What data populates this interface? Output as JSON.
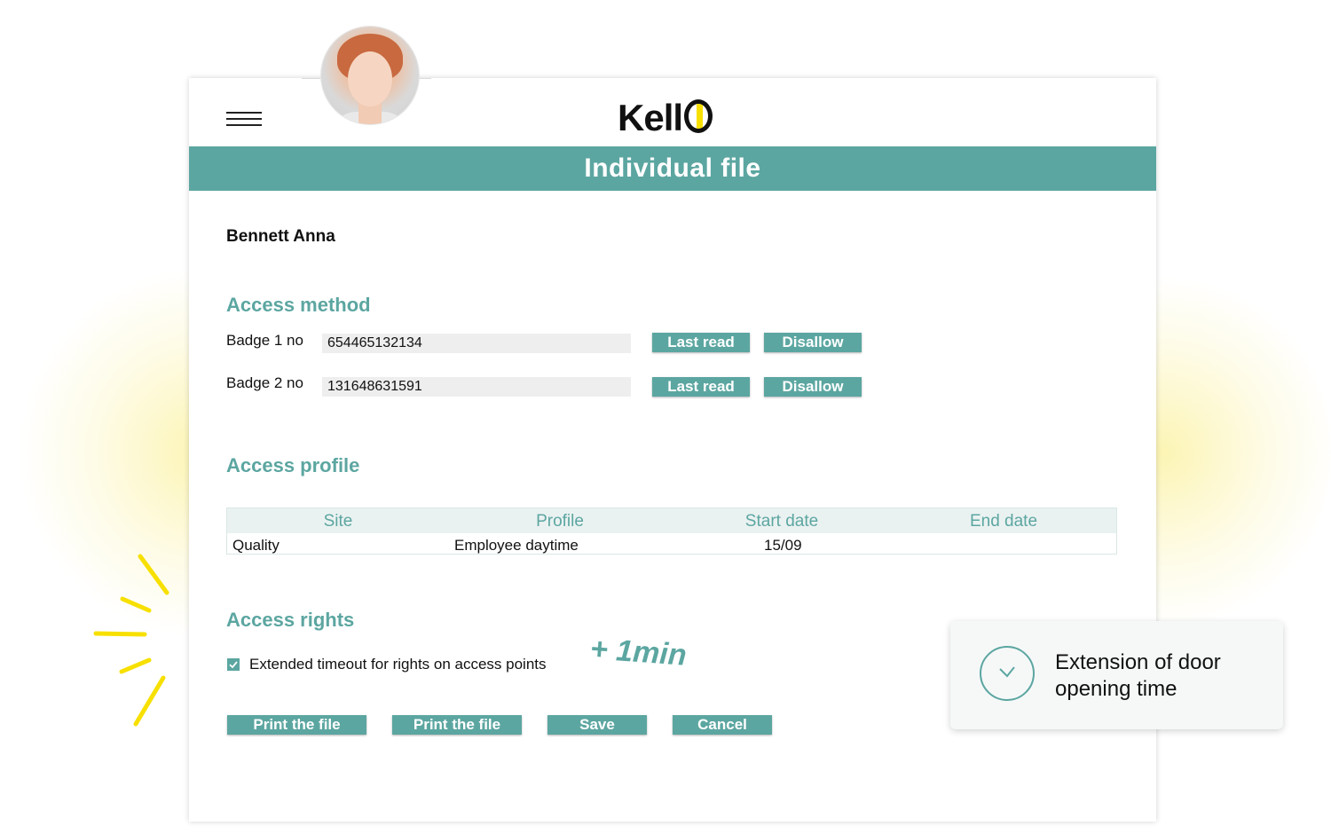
{
  "app": {
    "logo_text": "Kell"
  },
  "header": {
    "title": "Individual file"
  },
  "employee": {
    "name": "Bennett Anna"
  },
  "access_method": {
    "title": "Access method",
    "badges": [
      {
        "label": "Badge 1 no",
        "value": "654465132134",
        "last_read_label": "Last read",
        "disallow_label": "Disallow"
      },
      {
        "label": "Badge 2 no",
        "value": "131648631591",
        "last_read_label": "Last read",
        "disallow_label": "Disallow"
      }
    ]
  },
  "access_profile": {
    "title": "Access profile",
    "columns": [
      "Site",
      "Profile",
      "Start date",
      "End date"
    ],
    "rows": [
      {
        "site": "Quality",
        "profile": "Employee daytime",
        "start_date": "15/09",
        "end_date": ""
      }
    ]
  },
  "access_rights": {
    "title": "Access rights",
    "extended_timeout": {
      "label": "Extended timeout for rights on access points",
      "checked": true
    }
  },
  "actions": {
    "print_label_1": "Print the file",
    "print_label_2": "Print the file",
    "save_label": "Save",
    "cancel_label": "Cancel"
  },
  "annotation": {
    "text": "+ 1min"
  },
  "toast": {
    "message": "Extension of door opening time"
  },
  "colors": {
    "accent": "#5ca6a1",
    "highlight": "#f7e000",
    "field_bg": "#eeeeee"
  }
}
